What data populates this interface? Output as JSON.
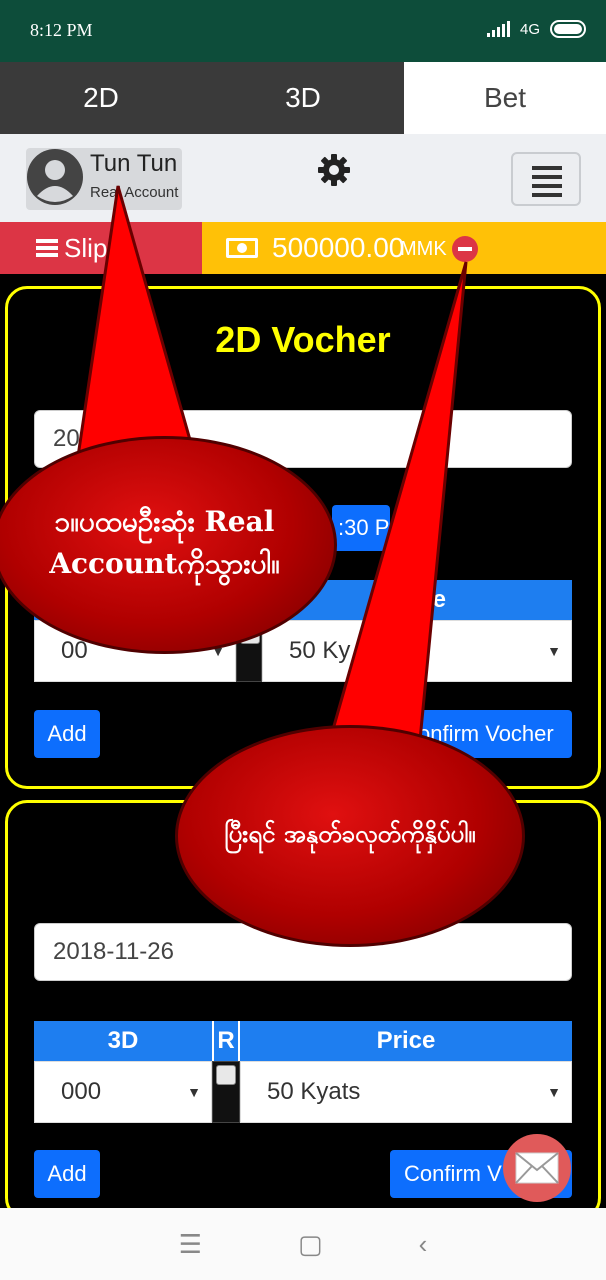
{
  "status": {
    "time": "8:12 PM",
    "network": "4G"
  },
  "tabs": [
    {
      "label": "2D",
      "active": false
    },
    {
      "label": "3D",
      "active": false
    },
    {
      "label": "Bet",
      "active": true
    }
  ],
  "user": {
    "name": "Tun Tun",
    "account_type": "Real Account"
  },
  "slips": {
    "label": "Slips"
  },
  "balance": {
    "amount": "500000.00",
    "currency": "MMK"
  },
  "voucher2d": {
    "title": "2D Vocher",
    "date_value": "2018",
    "time_value": ":30 P",
    "price_header": "e",
    "number_value": "00",
    "price_value": "50 Ky",
    "add_label": "Add",
    "confirm_label": "onfirm Vocher"
  },
  "voucher3d": {
    "date_value": "2018-11-26",
    "headers": [
      "3D",
      "R",
      "Price"
    ],
    "number_value": "000",
    "price_value": "50 Kyats",
    "add_label": "Add",
    "confirm_label": "Confirm V"
  },
  "callouts": {
    "first": "၁။ပထမဦးဆုံး Real Accountကိုသွားပါ။",
    "second": "ပြီးရင် အနုတ်ခလုတ်ကိုနှိပ်ပါ။"
  },
  "nav": {
    "menu": "☰",
    "home": "▢",
    "back": "‹"
  },
  "colors": {
    "status_bar": "#0d4d3a",
    "slips": "#dc3545",
    "balance": "#ffc107",
    "accent": "#1e7ef0",
    "card_border": "#ffff00"
  }
}
